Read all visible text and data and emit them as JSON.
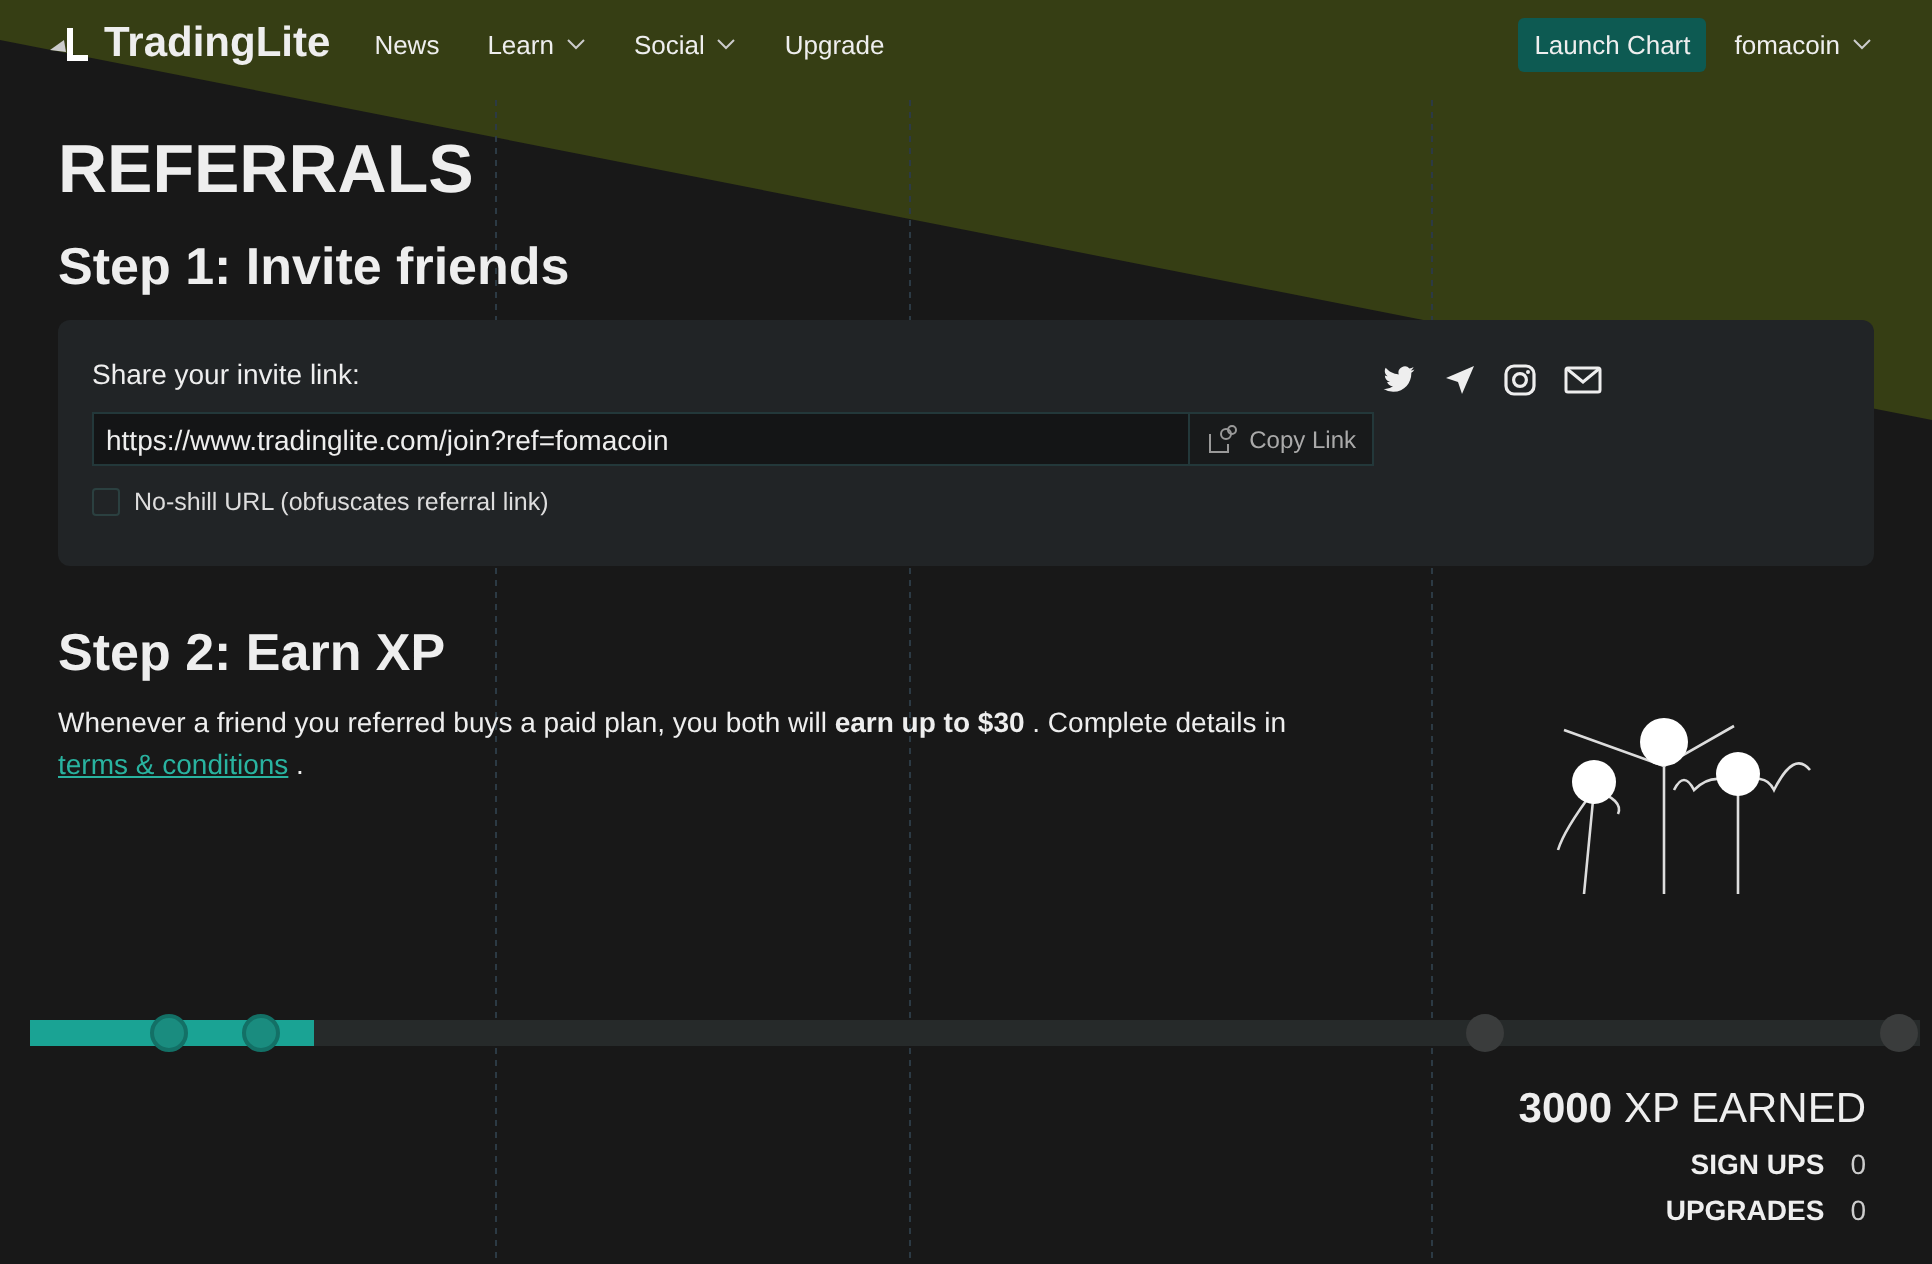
{
  "nav": {
    "logo": "TradingLite",
    "links": [
      {
        "label": "News",
        "dropdown": false
      },
      {
        "label": "Learn",
        "dropdown": true
      },
      {
        "label": "Social",
        "dropdown": true
      },
      {
        "label": "Upgrade",
        "dropdown": false
      }
    ],
    "launch_button": "Launch Chart",
    "user": "fomacoin"
  },
  "page_title": "REFERRALS",
  "step1": {
    "heading": "Step 1: Invite friends",
    "share_label": "Share your invite link:",
    "link": "https://www.tradinglite.com/join?ref=fomacoin",
    "copy_button": "Copy Link",
    "no_shill": {
      "label": "No-shill URL (obfuscates referral link)",
      "checked": false
    },
    "share_icons": [
      {
        "kind": "twitter"
      },
      {
        "kind": "telegram"
      },
      {
        "kind": "instagram"
      },
      {
        "kind": "email"
      }
    ]
  },
  "step2": {
    "heading": "Step 2: Earn XP",
    "text": "Whenever a friend you referred buys a paid plan, you both will **earn up to $30** . Complete details in",
    "link": "terms & conditions",
    "after_link": "."
  },
  "progress": {
    "level": 0.15,
    "milestones": [
      {
        "reached": true
      },
      {
        "reached": true
      },
      {
        "reached": false
      },
      {
        "reached": false
      }
    ]
  },
  "stats": {
    "xp_value": "3000",
    "xp_label": "XP EARNED",
    "rows": [
      {
        "label": "SIGN UPS",
        "value": "0"
      },
      {
        "label": "UPGRADES",
        "value": "0"
      }
    ]
  }
}
